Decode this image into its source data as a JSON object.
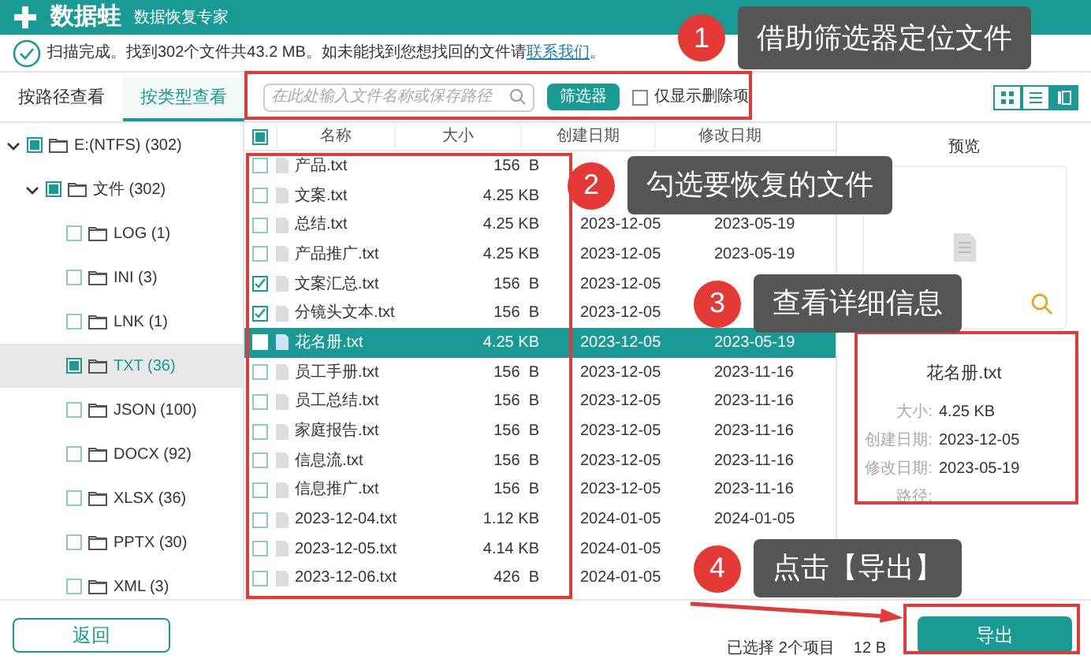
{
  "app": {
    "name": "数据蛙",
    "subtitle": "数据恢复专家"
  },
  "scan_message": {
    "text": "扫描完成。找到302个文件共43.2 MB。如未能找到您想找回的文件请",
    "link": "联系我们",
    "end": "。"
  },
  "tabs": [
    {
      "label": "按路径查看",
      "selected": false
    },
    {
      "label": "按类型查看",
      "selected": true
    }
  ],
  "search": {
    "placeholder": "在此处输入文件名称或保存路径"
  },
  "filter_button": "筛选器",
  "deleted_only": {
    "label": "仅显示删除项",
    "checked": false
  },
  "view_modes": [
    {
      "kind": "grid",
      "selected": false
    },
    {
      "kind": "list",
      "selected": false
    },
    {
      "kind": "detail",
      "selected": true
    }
  ],
  "tree": [
    {
      "label": "E:(NTFS) (302)",
      "checked": true,
      "expanded": true,
      "selected": false,
      "children": [
        {
          "label": "文件 (302)",
          "checked": true,
          "expanded": true,
          "selected": false,
          "children": [
            {
              "label": "LOG (1)",
              "checked": false,
              "selected": false
            },
            {
              "label": "INI (3)",
              "checked": false,
              "selected": false
            },
            {
              "label": "LNK (1)",
              "checked": false,
              "selected": false
            },
            {
              "label": "TXT (36)",
              "checked": true,
              "selected": true
            },
            {
              "label": "JSON (100)",
              "checked": false,
              "selected": false
            },
            {
              "label": "DOCX (92)",
              "checked": false,
              "selected": false
            },
            {
              "label": "XLSX (36)",
              "checked": false,
              "selected": false
            },
            {
              "label": "PPTX (30)",
              "checked": false,
              "selected": false
            },
            {
              "label": "XML (3)",
              "checked": false,
              "selected": false
            }
          ]
        }
      ]
    }
  ],
  "table": {
    "header_checked": true,
    "columns": [
      "名称",
      "大小",
      "创建日期",
      "修改日期"
    ],
    "rows": [
      {
        "name": "产品.txt",
        "size": "156  B",
        "checked": false,
        "selected": false
      },
      {
        "name": "文案.txt",
        "size": "4.25 KB",
        "checked": false,
        "selected": false
      },
      {
        "name": "总结.txt",
        "size": "4.25 KB",
        "created": "2023-12-05",
        "modified": "2023-05-19",
        "checked": false,
        "selected": false
      },
      {
        "name": "产品推广.txt",
        "size": "4.25 KB",
        "created": "2023-12-05",
        "modified": "2023-05-19",
        "checked": false,
        "selected": false
      },
      {
        "name": "文案汇总.txt",
        "size": "156  B",
        "created": "2023-12-05",
        "checked": true,
        "selected": false
      },
      {
        "name": "分镜头文本.txt",
        "size": "156  B",
        "created": "2023-12-05",
        "checked": true,
        "selected": false
      },
      {
        "name": "花名册.txt",
        "size": "4.25 KB",
        "created": "2023-12-05",
        "modified": "2023-05-19",
        "checked": false,
        "selected": true
      },
      {
        "name": "员工手册.txt",
        "size": "156  B",
        "created": "2023-12-05",
        "modified": "2023-11-16",
        "checked": false,
        "selected": false
      },
      {
        "name": "员工总结.txt",
        "size": "156  B",
        "created": "2023-12-05",
        "modified": "2023-11-16",
        "checked": false,
        "selected": false
      },
      {
        "name": "家庭报告.txt",
        "size": "156  B",
        "created": "2023-12-05",
        "modified": "2023-11-16",
        "checked": false,
        "selected": false
      },
      {
        "name": "信息流.txt",
        "size": "156  B",
        "created": "2023-12-05",
        "modified": "2023-11-16",
        "checked": false,
        "selected": false
      },
      {
        "name": "信息推广.txt",
        "size": "156  B",
        "created": "2023-12-05",
        "modified": "2023-11-16",
        "checked": false,
        "selected": false
      },
      {
        "name": "2023-12-04.txt",
        "size": "1.12 KB",
        "created": "2024-01-05",
        "modified": "2024-01-05",
        "checked": false,
        "selected": false
      },
      {
        "name": "2023-12-05.txt",
        "size": "4.14 KB",
        "created": "2024-01-05",
        "checked": false,
        "selected": false
      },
      {
        "name": "2023-12-06.txt",
        "size": "426  B",
        "created": "2024-01-05",
        "checked": false,
        "selected": false
      }
    ]
  },
  "preview": {
    "title": "预览",
    "file_name": "花名册.txt",
    "details": [
      {
        "label": "大小:",
        "value": "4.25 KB"
      },
      {
        "label": "创建日期:",
        "value": "2023-12-05"
      },
      {
        "label": "修改日期:",
        "value": "2023-05-19"
      },
      {
        "label": "路径:"
      }
    ]
  },
  "back_button": "返回",
  "status": [
    "已选择 2个项目",
    "12  B"
  ],
  "export_button": "导出",
  "annotations": [
    {
      "number": "1",
      "text": "借助筛选器定位文件"
    },
    {
      "number": "2",
      "text": "勾选要恢复的文件"
    },
    {
      "number": "3",
      "text": "查看详细信息"
    },
    {
      "number": "4",
      "text": "点击【导出】"
    }
  ]
}
